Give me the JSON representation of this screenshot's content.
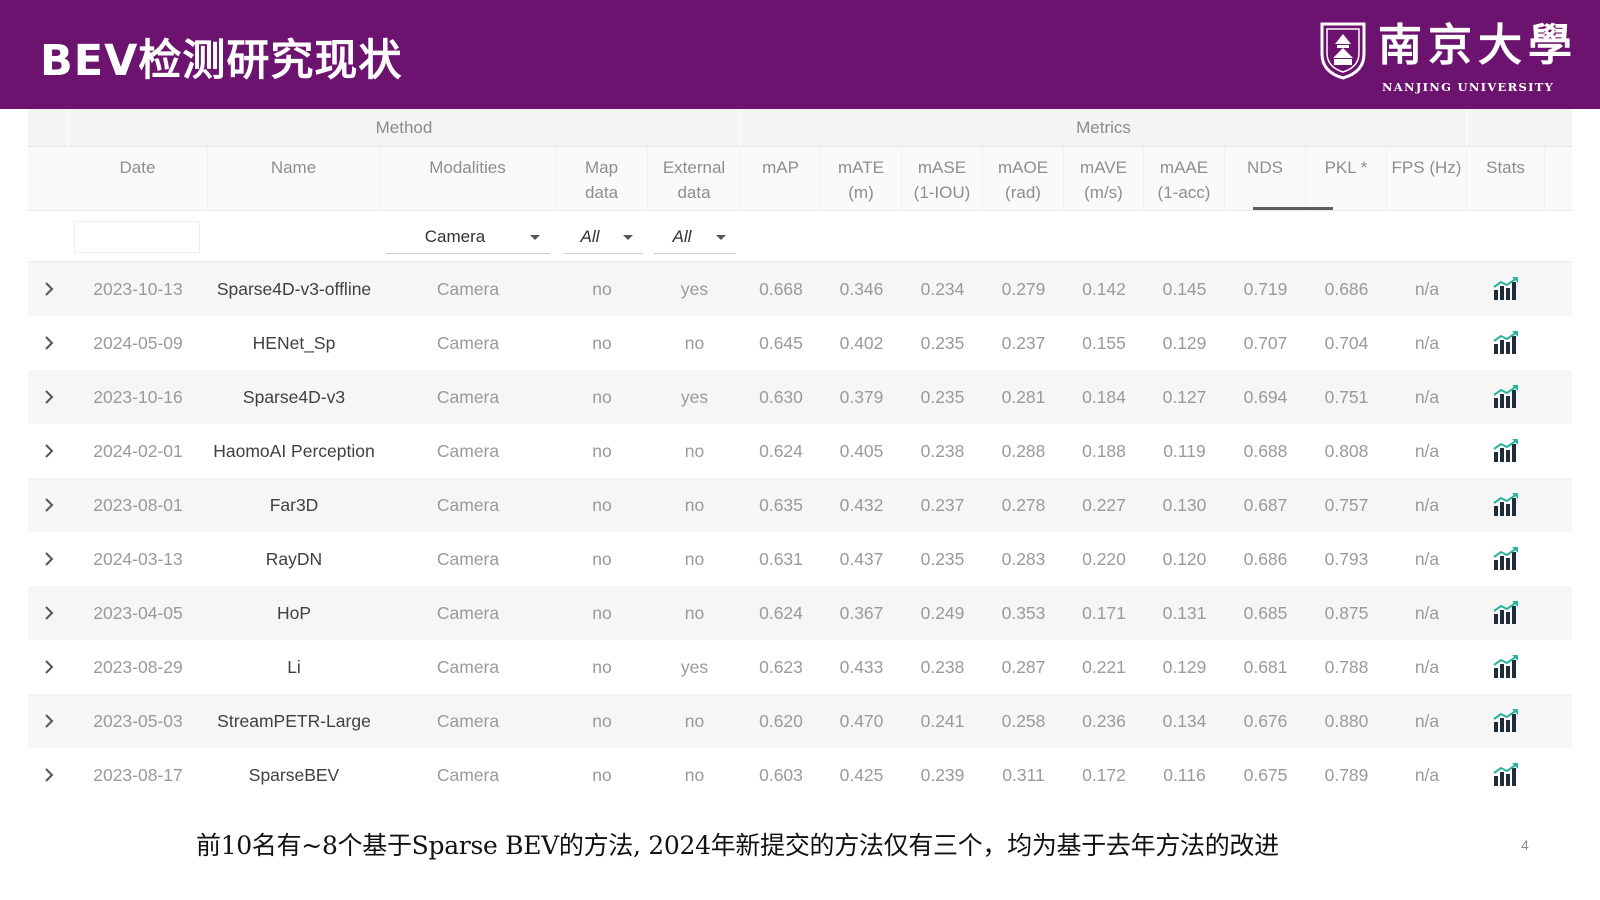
{
  "slide": {
    "title": "BEV检测研究现状",
    "logo_cn": "南京大學",
    "logo_en": "NANJING UNIVERSITY",
    "caption": "前10名有~8个基于Sparse BEV的方法, 2024年新提交的方法仅有三个，均为基于去年方法的改进",
    "page_number": "4",
    "colors": {
      "banner": "#6b136e",
      "stats_icon_dark": "#1f2d3a",
      "stats_icon_accent": "#2bb39a"
    }
  },
  "table": {
    "groups": {
      "method": "Method",
      "metrics": "Metrics"
    },
    "columns": [
      "Date",
      "Name",
      "Modalities",
      "Map\ndata",
      "External\ndata",
      "mAP",
      "mATE\n(m)",
      "mASE\n(1-IOU)",
      "mAOE\n(rad)",
      "mAVE\n(m/s)",
      "mAAE\n(1-acc)",
      "NDS",
      "PKL *",
      "FPS (Hz)",
      "Stats"
    ],
    "sorted_column": "NDS",
    "filters": {
      "date": "",
      "modalities": "Camera",
      "map_data": "All",
      "external_data": "All"
    },
    "rows": [
      {
        "date": "2023-10-13",
        "name": "Sparse4D-v3-offline",
        "modalities": "Camera",
        "map": "no",
        "external": "yes",
        "mAP": "0.668",
        "mATE": "0.346",
        "mASE": "0.234",
        "mAOE": "0.279",
        "mAVE": "0.142",
        "mAAE": "0.145",
        "NDS": "0.719",
        "PKL": "0.686",
        "FPS": "n/a"
      },
      {
        "date": "2024-05-09",
        "name": "HENet_Sp",
        "modalities": "Camera",
        "map": "no",
        "external": "no",
        "mAP": "0.645",
        "mATE": "0.402",
        "mASE": "0.235",
        "mAOE": "0.237",
        "mAVE": "0.155",
        "mAAE": "0.129",
        "NDS": "0.707",
        "PKL": "0.704",
        "FPS": "n/a"
      },
      {
        "date": "2023-10-16",
        "name": "Sparse4D-v3",
        "modalities": "Camera",
        "map": "no",
        "external": "yes",
        "mAP": "0.630",
        "mATE": "0.379",
        "mASE": "0.235",
        "mAOE": "0.281",
        "mAVE": "0.184",
        "mAAE": "0.127",
        "NDS": "0.694",
        "PKL": "0.751",
        "FPS": "n/a"
      },
      {
        "date": "2024-02-01",
        "name": "HaomoAI Perception",
        "modalities": "Camera",
        "map": "no",
        "external": "no",
        "mAP": "0.624",
        "mATE": "0.405",
        "mASE": "0.238",
        "mAOE": "0.288",
        "mAVE": "0.188",
        "mAAE": "0.119",
        "NDS": "0.688",
        "PKL": "0.808",
        "FPS": "n/a"
      },
      {
        "date": "2023-08-01",
        "name": "Far3D",
        "modalities": "Camera",
        "map": "no",
        "external": "no",
        "mAP": "0.635",
        "mATE": "0.432",
        "mASE": "0.237",
        "mAOE": "0.278",
        "mAVE": "0.227",
        "mAAE": "0.130",
        "NDS": "0.687",
        "PKL": "0.757",
        "FPS": "n/a"
      },
      {
        "date": "2024-03-13",
        "name": "RayDN",
        "modalities": "Camera",
        "map": "no",
        "external": "no",
        "mAP": "0.631",
        "mATE": "0.437",
        "mASE": "0.235",
        "mAOE": "0.283",
        "mAVE": "0.220",
        "mAAE": "0.120",
        "NDS": "0.686",
        "PKL": "0.793",
        "FPS": "n/a"
      },
      {
        "date": "2023-04-05",
        "name": "HoP",
        "modalities": "Camera",
        "map": "no",
        "external": "no",
        "mAP": "0.624",
        "mATE": "0.367",
        "mASE": "0.249",
        "mAOE": "0.353",
        "mAVE": "0.171",
        "mAAE": "0.131",
        "NDS": "0.685",
        "PKL": "0.875",
        "FPS": "n/a"
      },
      {
        "date": "2023-08-29",
        "name": "Li",
        "modalities": "Camera",
        "map": "no",
        "external": "yes",
        "mAP": "0.623",
        "mATE": "0.433",
        "mASE": "0.238",
        "mAOE": "0.287",
        "mAVE": "0.221",
        "mAAE": "0.129",
        "NDS": "0.681",
        "PKL": "0.788",
        "FPS": "n/a"
      },
      {
        "date": "2023-05-03",
        "name": "StreamPETR-Large",
        "modalities": "Camera",
        "map": "no",
        "external": "no",
        "mAP": "0.620",
        "mATE": "0.470",
        "mASE": "0.241",
        "mAOE": "0.258",
        "mAVE": "0.236",
        "mAAE": "0.134",
        "NDS": "0.676",
        "PKL": "0.880",
        "FPS": "n/a"
      },
      {
        "date": "2023-08-17",
        "name": "SparseBEV",
        "modalities": "Camera",
        "map": "no",
        "external": "no",
        "mAP": "0.603",
        "mATE": "0.425",
        "mASE": "0.239",
        "mAOE": "0.311",
        "mAVE": "0.172",
        "mAAE": "0.116",
        "NDS": "0.675",
        "PKL": "0.789",
        "FPS": "n/a"
      }
    ]
  }
}
